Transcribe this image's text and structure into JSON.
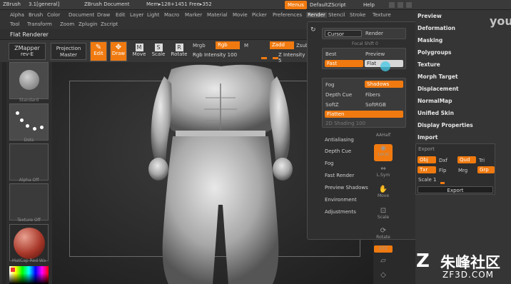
{
  "titlebar": {
    "app": "ZBrush",
    "version": "3.1[general]",
    "document": "ZBrush Document",
    "mem": "Mem▸128+1451 Free▸352",
    "menus_btn": "Menus",
    "default_script": "DefaultZScript",
    "help": "Help"
  },
  "menubar": [
    "Alpha",
    "Brush",
    "Color",
    "Document",
    "Draw",
    "Edit",
    "Layer",
    "Light",
    "Macro",
    "Marker",
    "Material",
    "Movie",
    "Picker",
    "Preferences",
    "Render",
    "Stencil",
    "Stroke",
    "Texture"
  ],
  "menubar2": [
    "Tool",
    "Transform",
    "Zoom",
    "Zplugin",
    "Zscript"
  ],
  "subtitle": "Flat Renderer",
  "toolbar": {
    "zmapper": "ZMapper",
    "zmapper_rev": "rev-E",
    "projection": "Projection",
    "master": "Master",
    "edit": "Edit",
    "draw": "Draw",
    "move": "Move",
    "scale": "Scale",
    "rotate": "Rotate",
    "mrgb": "Mrgb",
    "rgb": "Rgb",
    "m": "M",
    "zadd": "Zadd",
    "zsub": "Zsub",
    "rgb_intensity": "Rgb Intensity 100",
    "z_intensity": "Z Intensity 5"
  },
  "shelf": {
    "standard": "Standard",
    "dots": "Dots",
    "alpha_off": "Alpha Off",
    "texture_off": "Texture Off",
    "matcap": "MatCap Red Wa"
  },
  "render_panel": {
    "cursor": "Cursor",
    "render": "Render",
    "focal_shift": "Focal Shift 0",
    "best": "Best",
    "preview": "Preview",
    "fast": "Fast",
    "flat": "Flat",
    "fog": "Fog",
    "shadows": "Shadows",
    "depth_cue": "Depth Cue",
    "fibers": "Fibers",
    "softz": "SoftZ",
    "softrgb": "SoftRGB",
    "flatten": "Flatten",
    "zd_shading": "2D Shading 100",
    "antialiasing": "Antialiasing",
    "depth_cue2": "Depth Cue",
    "fog2": "Fog",
    "fast_render": "Fast Render",
    "preview_shadows": "Preview Shadows",
    "environment": "Environment",
    "adjustments": "Adjustments"
  },
  "right_menu": {
    "preview": "Preview",
    "deformation": "Deformation",
    "masking": "Masking",
    "polygroups": "Polygroups",
    "texture": "Texture",
    "morph_target": "Morph Target",
    "displacement": "Displacement",
    "normalmap": "NormalMap",
    "unified_skin": "Unified Skin",
    "display_properties": "Display Properties",
    "import": "Import",
    "export": "Export"
  },
  "export_panel": {
    "obj": "Obj",
    "dxf": "Dxf",
    "qud": "Qud",
    "tri": "Tri",
    "txr": "Txr",
    "flp": "Flp",
    "mrg": "Mrg",
    "grp": "Grp",
    "scale": "Scale 1",
    "export_btn": "Export"
  },
  "vtools": {
    "aahalf": "AAHalf",
    "local": "Local",
    "lsym": "L.Sym",
    "move": "Move",
    "scale": "Scale",
    "rotate": "Rotate",
    "xyz": "XYZ"
  },
  "watermark": {
    "main": "朱峰社区",
    "sub": "ZF3D.COM",
    "youku": "you"
  },
  "colors": {
    "accent": "#f07a10",
    "panel": "#2f2f2f",
    "background": "#2a2a2a"
  }
}
